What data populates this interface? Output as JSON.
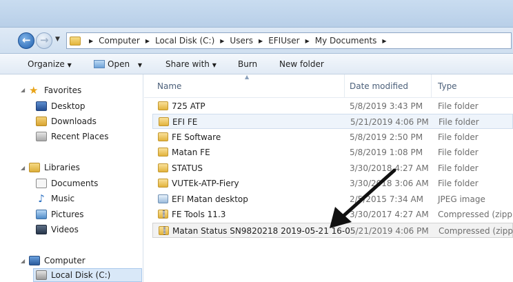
{
  "address": {
    "crumbs": [
      "Computer",
      "Local Disk (C:)",
      "Users",
      "EFIUser",
      "My Documents"
    ]
  },
  "toolbar": {
    "organize": "Organize",
    "open": "Open",
    "share_with": "Share with",
    "burn": "Burn",
    "new_folder": "New folder"
  },
  "nav": {
    "favorites": "Favorites",
    "desktop": "Desktop",
    "downloads": "Downloads",
    "recent_places": "Recent Places",
    "libraries": "Libraries",
    "documents": "Documents",
    "music": "Music",
    "pictures": "Pictures",
    "videos": "Videos",
    "computer": "Computer",
    "local_disk": "Local Disk (C:)"
  },
  "columns": {
    "name": "Name",
    "date_modified": "Date modified",
    "type": "Type"
  },
  "files": [
    {
      "name": "725 ATP",
      "date": "5/8/2019 3:43 PM",
      "type": "File folder",
      "icon": "folder"
    },
    {
      "name": "EFI FE",
      "date": "5/21/2019 4:06 PM",
      "type": "File folder",
      "icon": "folder"
    },
    {
      "name": "FE Software",
      "date": "5/8/2019 2:50 PM",
      "type": "File folder",
      "icon": "folder"
    },
    {
      "name": "Matan FE",
      "date": "5/8/2019 1:08 PM",
      "type": "File folder",
      "icon": "folder"
    },
    {
      "name": "STATUS",
      "date": "3/30/2018 4:27 AM",
      "type": "File folder",
      "icon": "folder"
    },
    {
      "name": "VUTEk-ATP-Fiery",
      "date": "3/30/2018 3:06 AM",
      "type": "File folder",
      "icon": "folder"
    },
    {
      "name": "EFI Matan desktop",
      "date": "2/5/2015 7:34 AM",
      "type": "JPEG image",
      "icon": "jpg"
    },
    {
      "name": "FE Tools 11.3",
      "date": "3/30/2017 4:27 AM",
      "type": "Compressed (zipp...",
      "icon": "zip"
    },
    {
      "name": "Matan Status SN9820218 2019-05-21 16-05",
      "date": "5/21/2019 4:06 PM",
      "type": "Compressed (zipp...",
      "icon": "zip"
    }
  ]
}
